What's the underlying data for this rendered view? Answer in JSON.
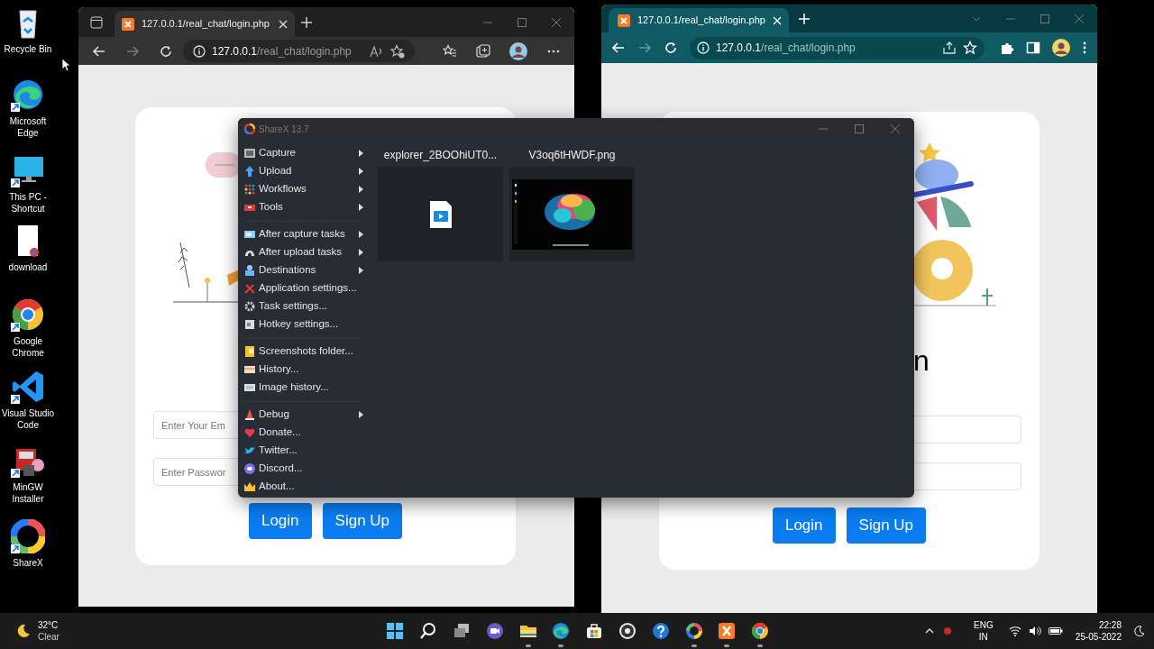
{
  "desktop_icons": [
    {
      "label": "Recycle Bin"
    },
    {
      "label": "Microsoft Edge"
    },
    {
      "label": "This PC - Shortcut"
    },
    {
      "label": "download"
    },
    {
      "label": "Google Chrome"
    },
    {
      "label": "Visual Studio Code"
    },
    {
      "label": "MinGW Installer"
    },
    {
      "label": "ShareX"
    }
  ],
  "edge_window": {
    "tab_title": "127.0.0.1/real_chat/login.php",
    "url_host": "127.0.0.1",
    "url_path": "/real_chat/login.php",
    "email_placeholder": "Enter Your Em",
    "password_placeholder": "Enter Passwor",
    "buttons": [
      "Login",
      "Sign Up"
    ]
  },
  "chrome_window": {
    "tab_title": "127.0.0.1/real_chat/login.php",
    "url_host": "127.0.0.1",
    "url_path": "/real_chat/login.php",
    "heading_fragment": "n",
    "buttons": [
      "Login",
      "Sign Up"
    ]
  },
  "sharex_window": {
    "title": "ShareX 13.7",
    "menu": [
      [
        {
          "label": "Capture",
          "submenu": true
        },
        {
          "label": "Upload",
          "submenu": true
        },
        {
          "label": "Workflows",
          "submenu": true
        },
        {
          "label": "Tools",
          "submenu": true
        }
      ],
      [
        {
          "label": "After capture tasks",
          "submenu": true
        },
        {
          "label": "After upload tasks",
          "submenu": true
        },
        {
          "label": "Destinations",
          "submenu": true
        },
        {
          "label": "Application settings...",
          "submenu": false
        },
        {
          "label": "Task settings...",
          "submenu": false
        },
        {
          "label": "Hotkey settings...",
          "submenu": false
        }
      ],
      [
        {
          "label": "Screenshots folder...",
          "submenu": false
        },
        {
          "label": "History...",
          "submenu": false
        },
        {
          "label": "Image history...",
          "submenu": false
        }
      ],
      [
        {
          "label": "Debug",
          "submenu": true
        },
        {
          "label": "Donate...",
          "submenu": false
        },
        {
          "label": "Twitter...",
          "submenu": false
        },
        {
          "label": "Discord...",
          "submenu": false
        },
        {
          "label": "About...",
          "submenu": false
        }
      ]
    ],
    "thumbnails": [
      {
        "name": "explorer_2BOOhiUT0...",
        "kind": "file"
      },
      {
        "name": "V3oq6tHWDF.png",
        "kind": "picture"
      }
    ]
  },
  "taskbar": {
    "temperature": "32°C",
    "weather": "Clear",
    "apps": [
      {
        "running": false
      },
      {
        "running": false
      },
      {
        "running": false
      },
      {
        "running": false
      },
      {
        "running": true
      },
      {
        "running": true
      },
      {
        "running": false
      },
      {
        "running": false
      },
      {
        "running": false
      },
      {
        "running": true
      },
      {
        "running": true
      },
      {
        "running": true
      }
    ],
    "language": "ENG",
    "region": "IN",
    "time": "22:28",
    "date": "25-05-2022"
  }
}
